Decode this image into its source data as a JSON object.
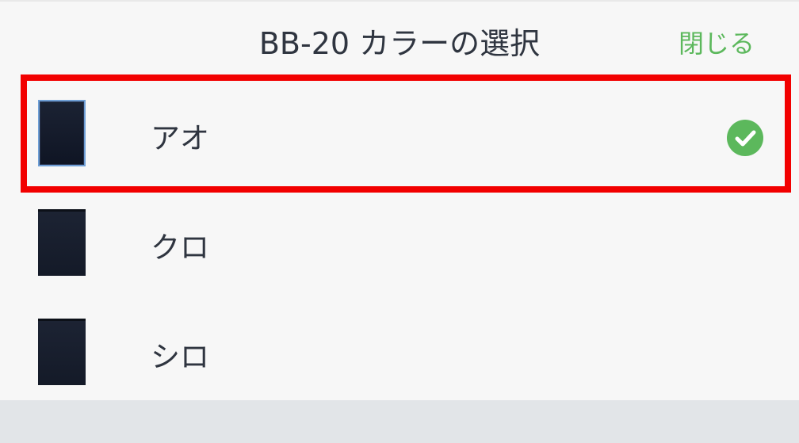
{
  "header": {
    "title": "BB-20 カラーの選択",
    "close_label": "閉じる"
  },
  "options": [
    {
      "label": "アオ",
      "selected": true
    },
    {
      "label": "クロ",
      "selected": false
    },
    {
      "label": "シロ",
      "selected": false
    }
  ],
  "colors": {
    "accent": "#5cb85c",
    "highlight": "#f20000",
    "text": "#2f3540"
  },
  "icons": {
    "check": "check-circle-icon"
  }
}
